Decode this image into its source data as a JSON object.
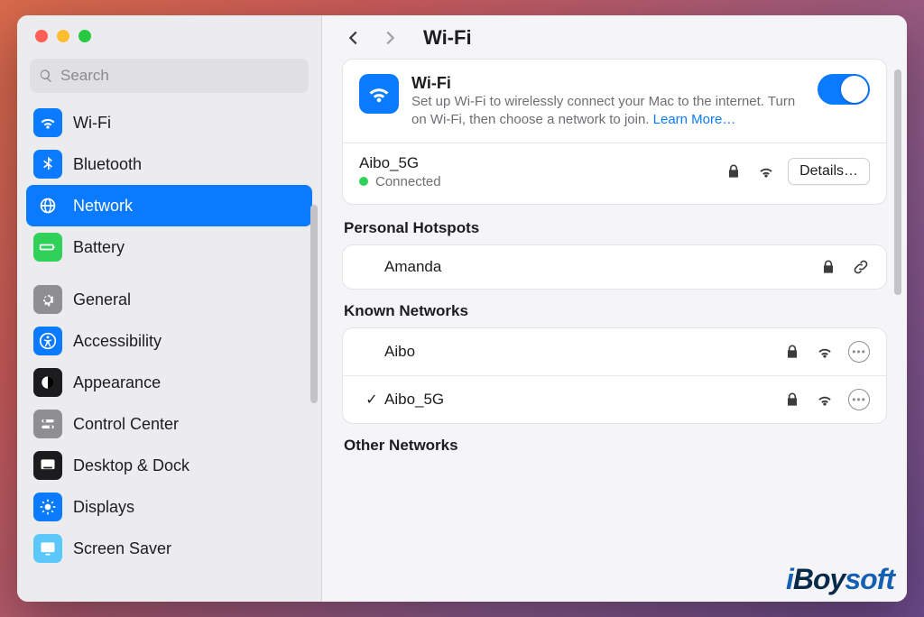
{
  "search": {
    "placeholder": "Search"
  },
  "sidebar": {
    "items": [
      {
        "label": "Wi-Fi"
      },
      {
        "label": "Bluetooth"
      },
      {
        "label": "Network"
      },
      {
        "label": "Battery"
      },
      {
        "label": "General"
      },
      {
        "label": "Accessibility"
      },
      {
        "label": "Appearance"
      },
      {
        "label": "Control Center"
      },
      {
        "label": "Desktop & Dock"
      },
      {
        "label": "Displays"
      },
      {
        "label": "Screen Saver"
      }
    ]
  },
  "header": {
    "title": "Wi-Fi"
  },
  "wifi": {
    "card_title": "Wi-Fi",
    "desc1": "Set up Wi-Fi to wirelessly connect your Mac to the internet. Turn on Wi-Fi, then choose a network to join. ",
    "learn_more": "Learn More…",
    "connected_name": "Aibo_5G",
    "connected_status": "Connected",
    "details_label": "Details…"
  },
  "sections": {
    "personal_hotspots": "Personal Hotspots",
    "known_networks": "Known Networks",
    "other_networks": "Other Networks"
  },
  "hotspots": [
    {
      "name": "Amanda"
    }
  ],
  "known": [
    {
      "name": "Aibo",
      "checked": false
    },
    {
      "name": "Aibo_5G",
      "checked": true
    }
  ],
  "watermark": {
    "i": "i",
    "boy": "Boy",
    "soft": "soft"
  }
}
